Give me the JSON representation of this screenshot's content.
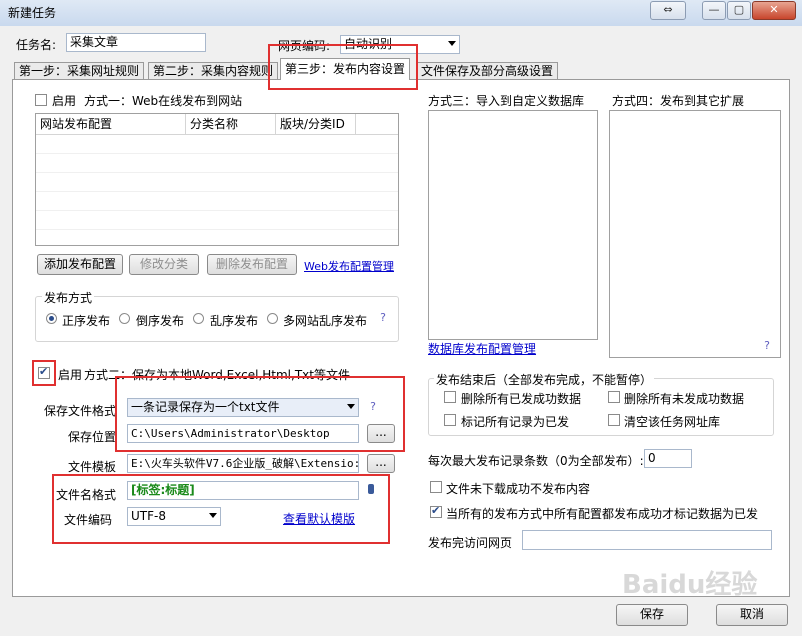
{
  "window": {
    "title": "新建任务",
    "restore_glyph": "⇔",
    "minimize_glyph": "—",
    "maximize_glyph": "▢",
    "close_glyph": "✕"
  },
  "task": {
    "name_label": "任务名:",
    "name_value": "采集文章",
    "encoding_label": "网页编码:",
    "encoding_value": "自动识别"
  },
  "tabs": [
    "第一步：采集网址规则",
    "第二步：采集内容规则",
    "第三步：发布内容设置",
    "文件保存及部分高级设置"
  ],
  "method1": {
    "enable_label": "启用",
    "title": "方式一：Web在线发布到网站",
    "enabled": false,
    "columns": [
      "网站发布配置",
      "分类名称",
      "版块/分类ID"
    ],
    "buttons": {
      "add": "添加发布配置",
      "edit": "修改分类",
      "delete": "删除发布配置"
    },
    "manage_link": "Web发布配置管理",
    "publish_mode_title": "发布方式",
    "modes": [
      "正序发布",
      "倒序发布",
      "乱序发布",
      "多网站乱序发布"
    ],
    "selected_mode": 0
  },
  "method2": {
    "enable_label": "启用",
    "title": "方式二：保存为本地Word,Excel,Html,Txt等文件",
    "enabled": true,
    "format_label": "保存文件格式",
    "format_value": "一条记录保存为一个txt文件",
    "location_label": "保存位置",
    "location_value": "C:\\Users\\Administrator\\Desktop",
    "template_label": "文件模板",
    "template_value": "E:\\火车头软件V7.6企业版_破解\\Extensio:",
    "filename_label": "文件名格式",
    "filename_value": "[标签:标题]",
    "file_encoding_label": "文件编码",
    "file_encoding_value": "UTF-8",
    "template_link": "查看默认模版",
    "browse_label": "..."
  },
  "method3": {
    "title": "方式三：导入到自定义数据库",
    "manage_link": "数据库发布配置管理"
  },
  "method4": {
    "title": "方式四：发布到其它扩展"
  },
  "after_publish": {
    "title": "发布结束后（全部发布完成，不能暂停）",
    "options": [
      "删除所有已发成功数据",
      "删除所有未发成功数据",
      "标记所有记录为已发",
      "清空该任务网址库"
    ]
  },
  "max_records": {
    "label": "每次最大发布记录条数（0为全部发布）:",
    "value": "0"
  },
  "no_publish_failed_label": "文件未下载成功不发布内容",
  "no_publish_failed_checked": false,
  "mark_all_label": "当所有的发布方式中所有配置都发布成功才标记数据为已发",
  "mark_all_checked": true,
  "visit_label": "发布完访问网页",
  "visit_value": "",
  "help_glyph": "?",
  "bottom": {
    "save": "保存",
    "cancel": "取消"
  },
  "watermark": "Baidu经验",
  "colors": {
    "annotation_red": "#e03030",
    "filename_green": "#1a8a1a",
    "link_blue": "#0000cc"
  }
}
